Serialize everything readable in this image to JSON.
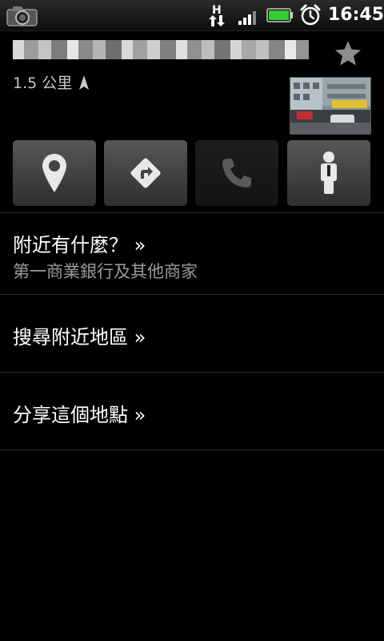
{
  "status_bar": {
    "time": "16:45",
    "icons": [
      "camera-notification-icon",
      "network-h-icon",
      "signal-icon",
      "battery-icon",
      "alarm-icon"
    ],
    "battery_color": "#33cc33"
  },
  "place": {
    "distance": "1.5 公里",
    "icons": [
      "star-icon",
      "direction-arrow-icon"
    ]
  },
  "actions": [
    {
      "name": "map-pin",
      "icon": "map-pin-icon"
    },
    {
      "name": "directions",
      "icon": "directions-icon"
    },
    {
      "name": "call",
      "icon": "phone-icon",
      "disabled": true
    },
    {
      "name": "street-view",
      "icon": "pegman-icon"
    }
  ],
  "menu": {
    "nearby": {
      "title": "附近有什麼？ »",
      "subtitle": "第一商業銀行及其他商家"
    },
    "search_nearby": {
      "title": "搜尋附近地區 »"
    },
    "share": {
      "title": "分享這個地點 »"
    }
  }
}
